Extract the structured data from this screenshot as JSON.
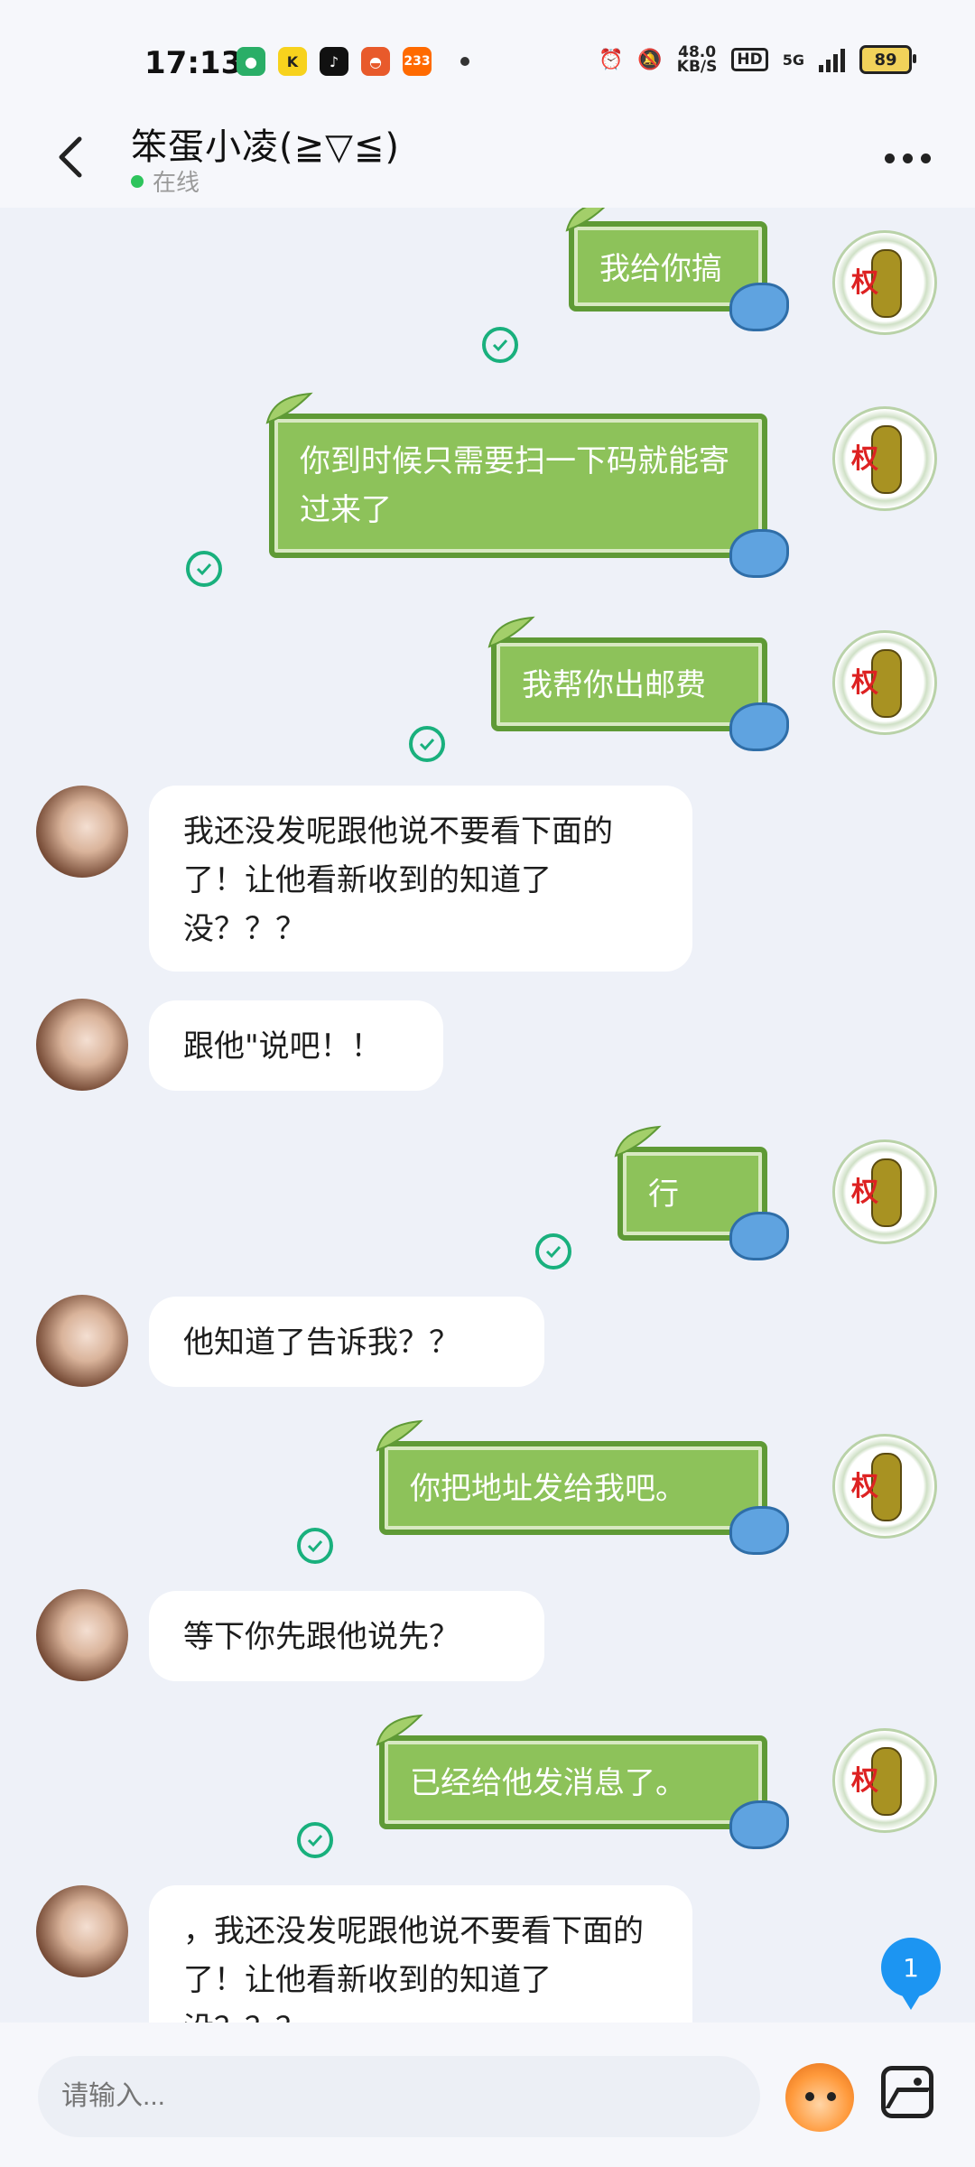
{
  "status_bar": {
    "time": "17:13",
    "net_speed": "48.0",
    "net_unit": "KB/S",
    "hd": "HD",
    "net_type": "5G",
    "battery": "89"
  },
  "header": {
    "title": "笨蛋小凌(≧▽≦)",
    "status": "在线"
  },
  "messages": [
    {
      "side": "me",
      "text": "我给你搞"
    },
    {
      "side": "me",
      "text": "你到时候只需要扫一下码就能寄过来了"
    },
    {
      "side": "me",
      "text": "我帮你出邮费"
    },
    {
      "side": "her",
      "text": "我还没发呢跟他说不要看下面的了！让他看新收到的知道了没？？？"
    },
    {
      "side": "her",
      "text": "跟他\"说吧！！"
    },
    {
      "side": "me",
      "text": "行"
    },
    {
      "side": "her",
      "text": "他知道了告诉我？？"
    },
    {
      "side": "me",
      "text": "你把地址发给我吧。"
    },
    {
      "side": "her",
      "text": "等下你先跟他说先？"
    },
    {
      "side": "me",
      "text": "已经给他发消息了。"
    },
    {
      "side": "her",
      "text": "，我还没发呢跟他说不要看下面的了！让他看新收到的知道了没？？？"
    }
  ],
  "unread_count": "1",
  "input": {
    "placeholder": "请输入..."
  }
}
